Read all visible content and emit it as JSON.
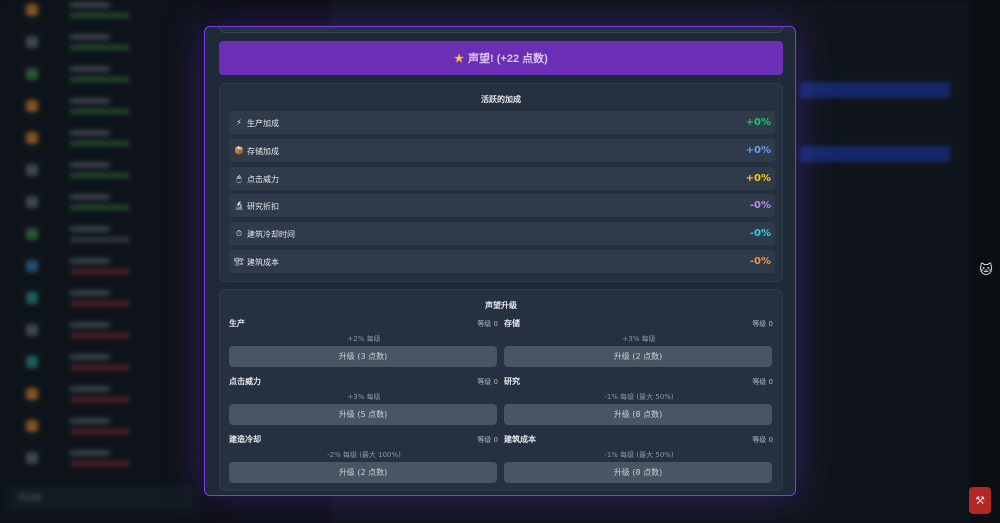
{
  "prestige_button": {
    "star": "★",
    "label": "声望! (+22 点数)"
  },
  "active_bonuses": {
    "title": "活跃的加成",
    "items": [
      {
        "icon": "⚡",
        "label": "生产加成",
        "value": "+0%",
        "color": "#22c55e"
      },
      {
        "icon": "📦",
        "label": "存储加成",
        "value": "+0%",
        "color": "#60a5fa"
      },
      {
        "icon": "🖱",
        "label": "点击威力",
        "value": "+0%",
        "color": "#facc15"
      },
      {
        "icon": "🔬",
        "label": "研究折扣",
        "value": "-0%",
        "color": "#c084fc"
      },
      {
        "icon": "⏱",
        "label": "建筑冷却时间",
        "value": "-0%",
        "color": "#22d3ee"
      },
      {
        "icon": "🏗",
        "label": "建筑成本",
        "value": "-0%",
        "color": "#fb923c"
      }
    ]
  },
  "prestige_upgrades": {
    "title": "声望升级",
    "items": [
      {
        "name": "生产",
        "level": "等级 0",
        "desc": "+2% 每级",
        "button": "升级 (3 点数)"
      },
      {
        "name": "存储",
        "level": "等级 0",
        "desc": "+3% 每级",
        "button": "升级 (2 点数)"
      },
      {
        "name": "点击威力",
        "level": "等级 0",
        "desc": "+3% 每级",
        "button": "升级 (5 点数)"
      },
      {
        "name": "研究",
        "level": "等级 0",
        "desc": "-1% 每级 (最大 50%)",
        "button": "升级 (8 点数)"
      },
      {
        "name": "建造冷却",
        "level": "等级 0",
        "desc": "-2% 每级 (最大 100%)",
        "button": "升级 (2 点数)"
      },
      {
        "name": "建筑成本",
        "level": "等级 0",
        "desc": "-1% 每级 (最大 50%)",
        "button": "升级 (8 点数)"
      }
    ]
  },
  "background": {
    "chat_label": "说话框"
  },
  "icons": {
    "side": "🐱",
    "corner": "⚒"
  }
}
